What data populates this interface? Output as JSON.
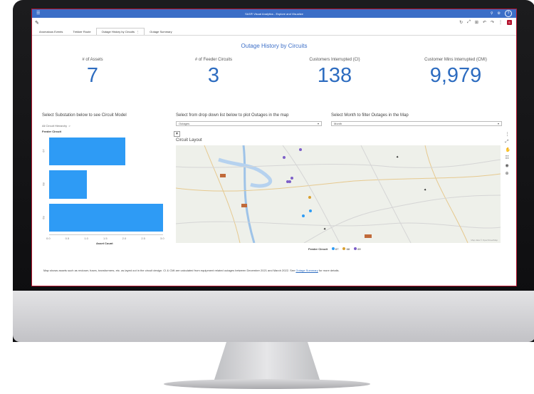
{
  "app": {
    "title": "SAS® Visual Analytics - Explore and Visualize",
    "badge": "S"
  },
  "tabs": [
    {
      "label": "Anomalous Events"
    },
    {
      "label": "Trekker Route"
    },
    {
      "label": "Outage History by Circuits",
      "menu": "⋮",
      "active": true
    },
    {
      "label": "Outage Summary"
    }
  ],
  "page_title": "Outage History by Circuits",
  "kpis": [
    {
      "label": "# of Assets",
      "value": "7"
    },
    {
      "label": "# of Feeder Circuits",
      "value": "3"
    },
    {
      "label": "Customers Interrupted (CI)",
      "value": "138"
    },
    {
      "label": "Customer Mins Interrupted (CMI)",
      "value": "9,979"
    }
  ],
  "left_panel": {
    "heading": "Select Substation below to see Circuit Model",
    "hierarchy": "All Circuit Hierarchy",
    "hierarchy_sep": ">",
    "y_title": "Feeder Circuit"
  },
  "chart_data": {
    "type": "bar",
    "orientation": "horizontal",
    "categories": [
      "67",
      "68",
      "69"
    ],
    "values": [
      2.0,
      1.0,
      3.0
    ],
    "xlabel": "Asset Count",
    "ylabel": "Feeder Circuit",
    "xlim": [
      0,
      3
    ],
    "x_ticks": [
      "0.0",
      "0.5",
      "1.0",
      "1.5",
      "2.0",
      "2.5",
      "3.0"
    ],
    "color": "#2e9bf5"
  },
  "middle": {
    "heading": "Select from drop down list below to plot Outages in the map",
    "dropdown_value": "Outages",
    "expand_glyph": "▼",
    "circuit_layout": "Circuit Layout"
  },
  "right": {
    "heading": "Select Month to filter Outages in the Map",
    "dropdown_value": "Month"
  },
  "map": {
    "attribution": "Map data © OpenStreetMap",
    "legend_title": "Feeder Circuit",
    "legend": [
      {
        "name": "67",
        "color": "#2e9bf5"
      },
      {
        "name": "68",
        "color": "#d9a030"
      },
      {
        "name": "69",
        "color": "#7d5fc8"
      }
    ]
  },
  "footer": {
    "text": "Map shows assets such as recloser, fuses, transformers, etc. as layed out in the circuit design. CI & CMI are calculated from equipment related outages between December 2021 and March 2022. See",
    "link": "Outage Summary",
    "suffix": "for more details."
  }
}
